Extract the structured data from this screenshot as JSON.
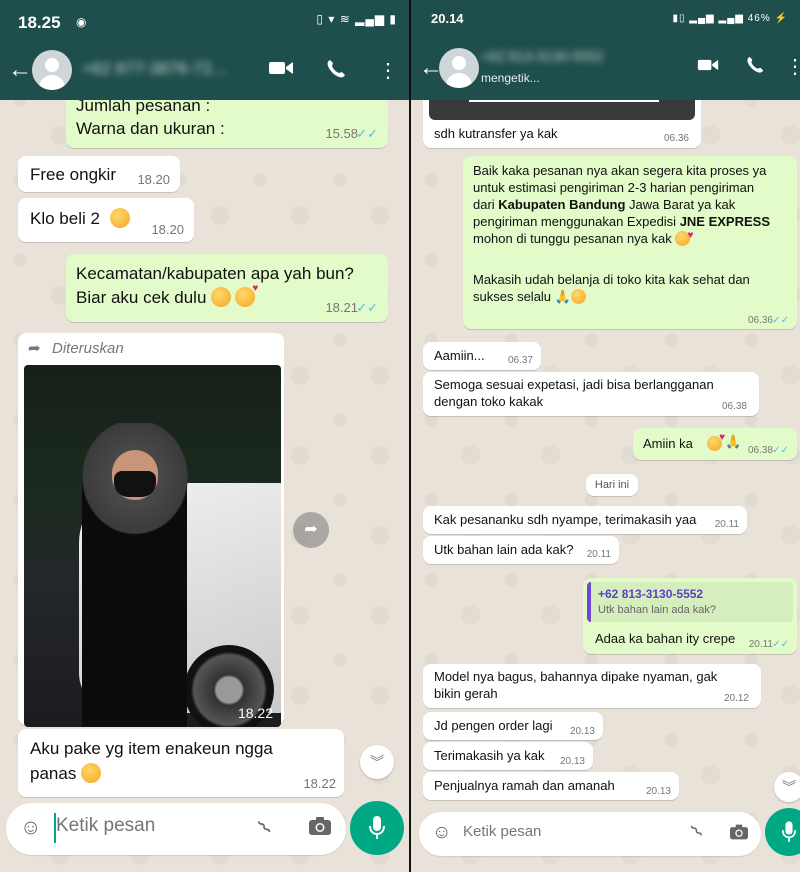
{
  "left": {
    "status": {
      "time": "18.25"
    },
    "header": {
      "contact": "+62 877-3876-72..."
    },
    "messages": [
      {
        "id": "l0",
        "dir": "out",
        "lines": [
          "Jumlah pesanan :",
          "Warna dan ukuran :"
        ],
        "time": "15.58"
      },
      {
        "id": "l1",
        "dir": "in",
        "text": "Free ongkir",
        "time": "18.20"
      },
      {
        "id": "l2",
        "dir": "in",
        "text": "Klo beli 2",
        "time": "18.20"
      },
      {
        "id": "l3",
        "dir": "out",
        "lines": [
          "Kecamatan/kabupaten apa yah bun?",
          "Biar aku cek dulu"
        ],
        "time": "18.21"
      },
      {
        "id": "l4",
        "dir": "in",
        "forwarded": "Diteruskan",
        "time": "18.22"
      },
      {
        "id": "l5",
        "dir": "in",
        "lines": [
          "Aku pake yg item enakeun ngga",
          "panas"
        ],
        "time": "18.22"
      }
    ],
    "input": {
      "placeholder": "Ketik pesan"
    }
  },
  "right": {
    "status": {
      "time": "20.14",
      "indicators": "46%"
    },
    "header": {
      "contact": "+62 813-3130-5552",
      "subtitle": "mengetik..."
    },
    "messages": [
      {
        "id": "r0",
        "dir": "in",
        "text": "sdh kutransfer ya kak",
        "time": "06.36"
      },
      {
        "id": "r1",
        "dir": "out",
        "time": "06.36",
        "p1": {
          "a": "Baik kaka pesanan nya akan segera kita proses ya",
          "b": "untuk estimasi pengiriman 2-3 harian pengiriman",
          "c_pre": "dari ",
          "c_bold": "Kabupaten Bandung",
          "c_post": " Jawa Barat ya kak",
          "d_pre": "pengiriman menggunakan Expedisi ",
          "d_bold": "JNE EXPRESS",
          "e": "mohon di tunggu pesanan nya kak"
        },
        "p2": {
          "a": "Makasih udah belanja di toko kita kak sehat dan",
          "b": "sukses selalu"
        }
      },
      {
        "id": "r2",
        "dir": "in",
        "text": "Aamiin...",
        "time": "06.37"
      },
      {
        "id": "r3",
        "dir": "in",
        "lines": [
          "Semoga sesuai expetasi, jadi bisa berlangganan",
          "dengan toko kakak"
        ],
        "time": "06.38"
      },
      {
        "id": "r4",
        "dir": "out",
        "text": "Amiin ka",
        "time": "06.38"
      },
      {
        "id": "r5",
        "dir": "in",
        "text": "Kak pesananku sdh nyampe, terimakasih yaa",
        "time": "20.11"
      },
      {
        "id": "r6",
        "dir": "in",
        "text": "Utk bahan lain ada kak?",
        "time": "20.11"
      },
      {
        "id": "r7",
        "dir": "out",
        "quote_name": "+62 813-3130-5552",
        "quote_text": "Utk bahan lain ada kak?",
        "text": "Adaa ka bahan ity crepe",
        "time": "20.11"
      },
      {
        "id": "r8",
        "dir": "in",
        "lines": [
          "Model nya bagus, bahannya dipake nyaman, gak",
          "bikin gerah"
        ],
        "time": "20.12"
      },
      {
        "id": "r9",
        "dir": "in",
        "text": "Jd pengen order lagi",
        "time": "20.13"
      },
      {
        "id": "r10",
        "dir": "in",
        "text": "Terimakasih ya kak",
        "time": "20.13"
      },
      {
        "id": "r11",
        "dir": "in",
        "text": "Penjualnya ramah dan amanah",
        "time": "20.13"
      }
    ],
    "date_chip": "Hari ini",
    "input": {
      "placeholder": "Ketik pesan"
    }
  },
  "colors": {
    "header": "#1f4f4c",
    "outgoing_bubble": "#e2fbc9",
    "incoming_bubble": "#ffffff",
    "send_button": "#00a884",
    "read_tick": "#53bdeb"
  },
  "icons": [
    "back-arrow-icon",
    "video-call-icon",
    "phone-icon",
    "more-options-icon",
    "emoji-icon",
    "attach-icon",
    "camera-icon",
    "mic-icon",
    "forward-icon",
    "scroll-down-icon",
    "read-ticks-icon"
  ]
}
